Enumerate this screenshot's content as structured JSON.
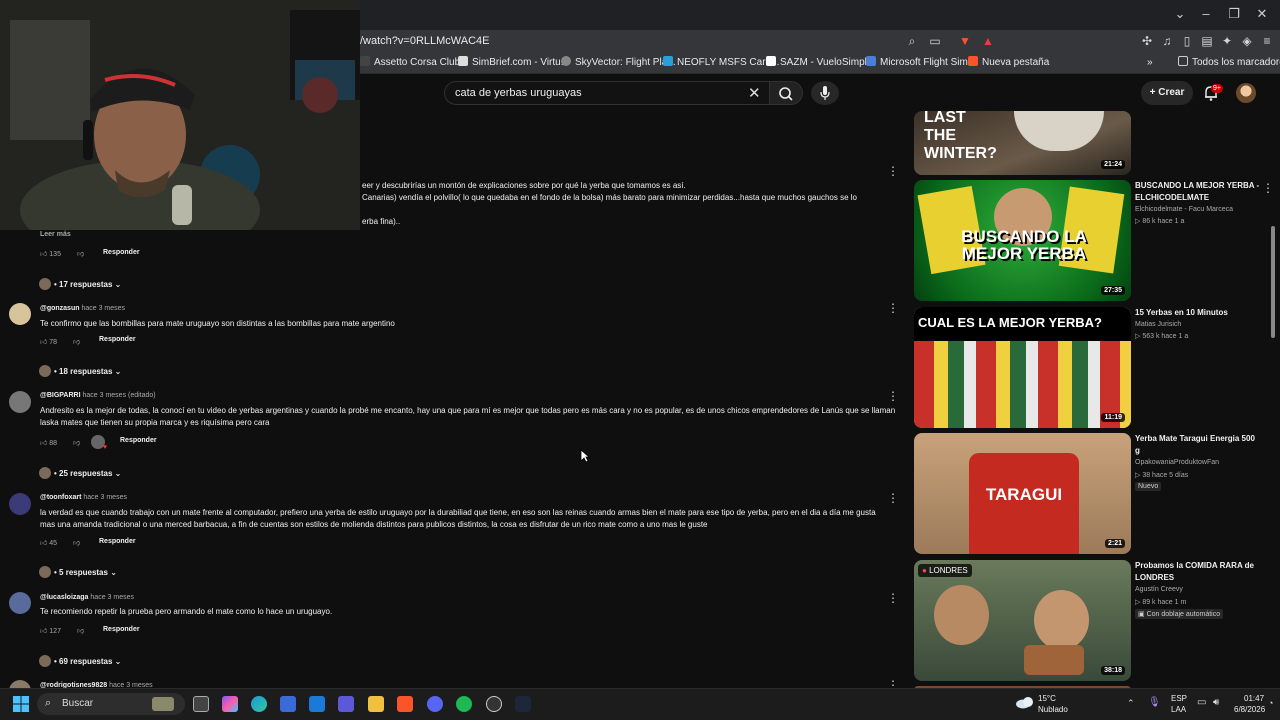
{
  "browser": {
    "url": "/watch?v=0RLLMcWAC4E",
    "bookmarks": [
      "Assetto Corsa Club...",
      "SimBrief.com - Virtu...",
      "SkyVector: Flight Pla...",
      "NEOFLY MSFS Care...",
      "SAZM - VueloSimple",
      "Microsoft Flight Sim...",
      "Nueva pestaña"
    ],
    "all_bookmarks": "Todos los marcadores",
    "colors": {
      "tab_bar": "#202124",
      "toolbar": "#35363a"
    }
  },
  "youtube": {
    "search_query": "cata de yerbas uruguayas",
    "create_label": "Crear",
    "notif_count": "9+"
  },
  "comments": {
    "partial_top": {
      "line1": "eer y descubrirías un montón de explicaciones sobre por qué la yerba que tomamos es así.",
      "line2": "Canarias) vendía el polvillo( lo que quedaba en el fondo de la bolsa) más barato para minimizar perdidas...hasta que muchos gauchos se lo",
      "line3": "erba fina)..",
      "read_more": "Leer más",
      "likes": "135",
      "reply": "Responder",
      "replies": "17 respuestas"
    },
    "items": [
      {
        "author": "@gonzasun",
        "time": "hace 3 meses",
        "text": "Te confirmo que las bombillas para mate uruguayo son distintas a las bombillas para mate argentino",
        "likes": "78",
        "reply": "Responder",
        "replies": "18 respuestas"
      },
      {
        "author": "@BIGPARRI",
        "time": "hace 3 meses (editado)",
        "text": "Andresito es la mejor de todas, la conocí en tu video de yerbas argentinas y cuando la probé me encanto, hay una que para mí es mejor que todas pero es más cara y no es popular, es de unos chicos emprendedores de Lanús que se llaman laska mates que tienen su propia marca y es riquísima pero cara",
        "likes": "88",
        "reply": "Responder",
        "replies": "25 respuestas"
      },
      {
        "author": "@toonfoxart",
        "time": "hace 3 meses",
        "text": "la verdad es que cuando trabajo con un mate frente al computador, prefiero una yerba de estilo uruguayo por la durabiliad que tiene, en eso son las reinas cuando armas bien el mate para ese tipo de yerba,  pero en el dia a día me gusta mas una amanda tradicional o una merced barbacua, a fin de cuentas  son estilos de molienda distintos para publicos distintos, la cosa es disfrutar de un rico mate como a uno mas le guste",
        "likes": "45",
        "reply": "Responder",
        "replies": "5 respuestas"
      },
      {
        "author": "@lucasloizaga",
        "time": "hace 3 meses",
        "text": "Te recomiendo repetir la prueba pero armando el mate como lo hace un uruguayo.",
        "likes": "127",
        "reply": "Responder",
        "replies": "69 respuestas"
      },
      {
        "author": "@rodrigotisnes9828",
        "time": "hace 3 meses"
      }
    ]
  },
  "sidebar": {
    "videos": [
      {
        "title": "",
        "duration": "21:24",
        "thumb_text": "LAST THE WINTER?"
      },
      {
        "title": "BUSCANDO LA MEJOR YERBA - ELCHICODELMATE",
        "channel": "Elchicodelmate - Facu Marceca",
        "meta": "86 k  hace 1 a",
        "duration": "27:35",
        "thumb_text": "BUSCANDO LA MEJOR YERBA"
      },
      {
        "title": "15 Yerbas en 10 Minutos",
        "channel": "Matias Jurisich",
        "meta": "563 k  hace 1 a",
        "duration": "11:19",
        "thumb_text": "CUAL ES LA MEJOR YERBA?"
      },
      {
        "title": "Yerba Mate Taragui Energia 500 g",
        "channel": "OpakowaniaProduktowFan",
        "meta": "38  hace 5 días",
        "badge": "Nuevo",
        "duration": "2:21",
        "thumb_text": "TARAGUI"
      },
      {
        "title": "Probamos la COMIDA RARA de LONDRES",
        "channel": "Agustín Creevy",
        "meta": "89 k  hace 1 m",
        "badge": "Con doblaje automático",
        "duration": "38:18",
        "thumb_text": "LONDRES"
      }
    ]
  },
  "taskbar": {
    "search": "Buscar",
    "temp": "15°C",
    "weather": "Nublado",
    "lang1": "ESP",
    "lang2": "LAA",
    "time": "01:47",
    "date": "6/8/2026"
  }
}
